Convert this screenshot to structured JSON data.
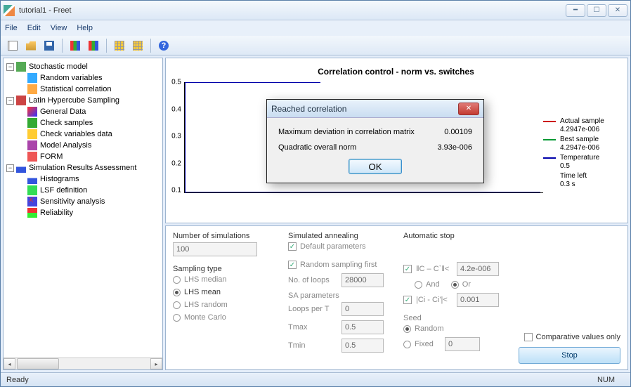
{
  "window": {
    "title": "tutorial1 - Freet"
  },
  "menu": {
    "file": "File",
    "edit": "Edit",
    "view": "View",
    "help": "Help"
  },
  "tree": {
    "stochastic": "Stochastic model",
    "rand_vars": "Random variables",
    "stat_corr": "Statistical correlation",
    "lhs": "Latin Hypercube Sampling",
    "gen_data": "General Data",
    "check_samples": "Check samples",
    "check_vars": "Check variables data",
    "model_analysis": "Model Analysis",
    "form": "FORM",
    "sra": "Simulation Results Assessment",
    "histograms": "Histograms",
    "lsf_def": "LSF definition",
    "sensitivity": "Sensitivity analysis",
    "reliability": "Reliability"
  },
  "chart": {
    "title": "Correlation control - norm vs. switches"
  },
  "chart_data": {
    "type": "line",
    "title": "Correlation control - norm vs. switches",
    "xlabel": "",
    "ylabel": "",
    "ylim": [
      0,
      0.5
    ],
    "yticks": [
      0.1,
      0.2,
      0.3,
      0.4,
      0.5
    ],
    "series": [
      {
        "name": "Actual sample",
        "color": "#cc0000",
        "value": 4.2947e-06
      },
      {
        "name": "Best sample",
        "color": "#009933",
        "value": 4.2947e-06
      },
      {
        "name": "Temperature",
        "color": "#0000aa",
        "value": 0.5
      }
    ],
    "temperature_profile_note": "Temperature starts at 0.5 and drops rapidly to near 0"
  },
  "legend": {
    "actual": {
      "label": "Actual sample",
      "value": "4.2947e-006",
      "color": "#cc0000"
    },
    "best": {
      "label": "Best sample",
      "value": "4.2947e-006",
      "color": "#009933"
    },
    "temp": {
      "label": "Temperature",
      "value": "0.5",
      "color": "#0000aa"
    },
    "timeleft": {
      "label": "Time left",
      "value": "0.3 s"
    }
  },
  "dialog": {
    "title": "Reached correlation",
    "row1_label": "Maximum deviation in correlation matrix",
    "row1_value": "0.00109",
    "row2_label": "Quadratic overall norm",
    "row2_value": "3.93e-006",
    "ok": "OK"
  },
  "controls": {
    "num_sim_label": "Number of simulations",
    "num_sim_value": "100",
    "sampling_type": "Sampling type",
    "lhs_median": "LHS median",
    "lhs_mean": "LHS mean",
    "lhs_random": "LHS random",
    "monte_carlo": "Monte Carlo",
    "sa_title": "Simulated annealing",
    "default_params": "Default parameters",
    "random_first": "Random sampling first",
    "no_loops_label": "No. of loops",
    "no_loops_value": "28000",
    "sa_params": "SA parameters",
    "loops_per_t_label": "Loops per T",
    "loops_per_t_value": "0",
    "tmax_label": "Tmax",
    "tmax_value": "0.5",
    "tmin_label": "Tmin",
    "tmin_value": "0.5",
    "auto_stop": "Automatic stop",
    "cc_norm": "‖C – C`‖<",
    "cc_val": "4.2e-006",
    "and": "And",
    "or": "Or",
    "cici": "|Ci - Ci'|<",
    "cici_val": "0.001",
    "seed": "Seed",
    "random": "Random",
    "fixed": "Fixed",
    "fixed_val": "0",
    "comparative": "Comparative values only",
    "stop": "Stop"
  },
  "status": {
    "ready": "Ready",
    "num": "NUM"
  }
}
